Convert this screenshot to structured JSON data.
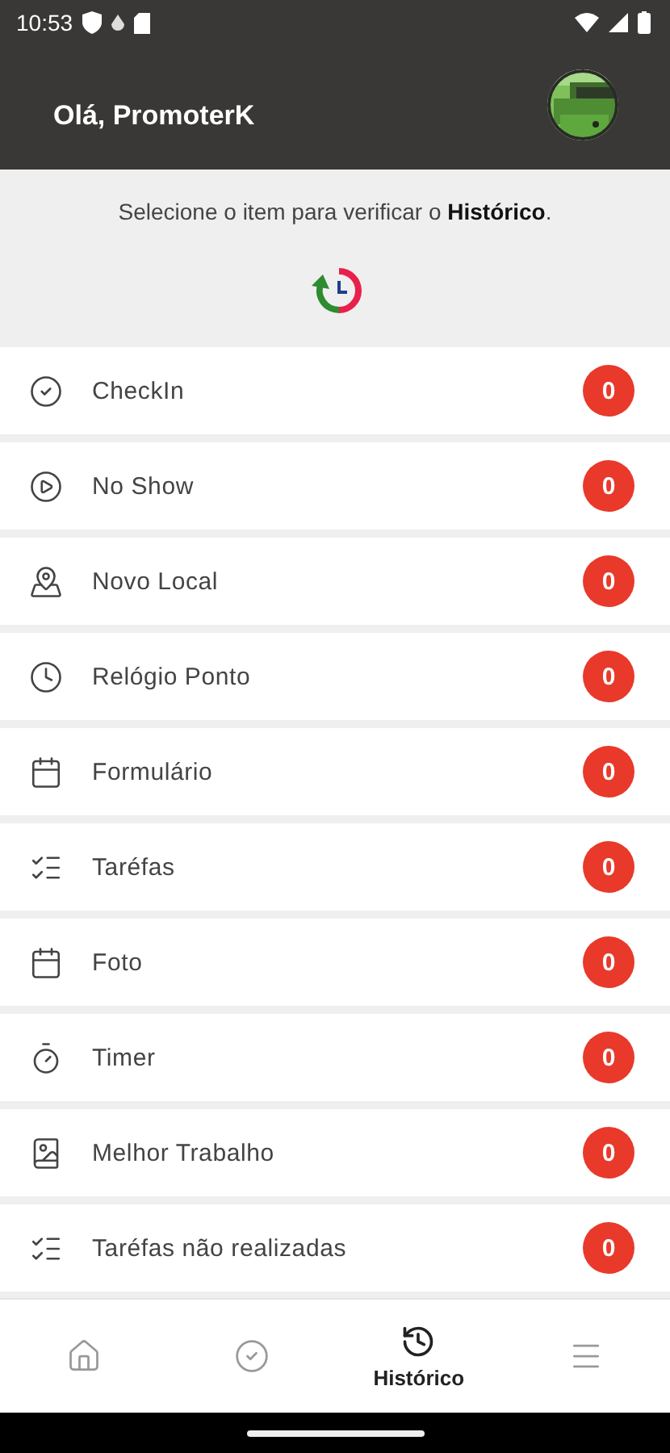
{
  "status_bar": {
    "time": "10:53"
  },
  "header": {
    "greeting": "Olá, PromoterK"
  },
  "intro": {
    "text": "Selecione o item para verificar o **Histórico**."
  },
  "items": [
    {
      "label": "CheckIn",
      "count": "0",
      "kind": "check"
    },
    {
      "label": "No Show",
      "count": "0",
      "kind": "play"
    },
    {
      "label": "Novo Local",
      "count": "0",
      "kind": "map"
    },
    {
      "label": "Relógio Ponto",
      "count": "0",
      "kind": "clock"
    },
    {
      "label": "Formulário",
      "count": "0",
      "kind": "form"
    },
    {
      "label": "Taréfas",
      "count": "0",
      "kind": "list"
    },
    {
      "label": "Foto",
      "count": "0",
      "kind": "form"
    },
    {
      "label": "Timer",
      "count": "0",
      "kind": "timer"
    },
    {
      "label": "Melhor Trabalho",
      "count": "0",
      "kind": "book"
    },
    {
      "label": "Taréfas não realizadas",
      "count": "0",
      "kind": "list"
    }
  ],
  "nav": [
    {
      "kind": "home",
      "selected": false
    },
    {
      "kind": "check",
      "selected": false
    },
    {
      "kind": "history",
      "label": "Histórico",
      "selected": true
    },
    {
      "kind": "menu",
      "selected": false
    }
  ]
}
